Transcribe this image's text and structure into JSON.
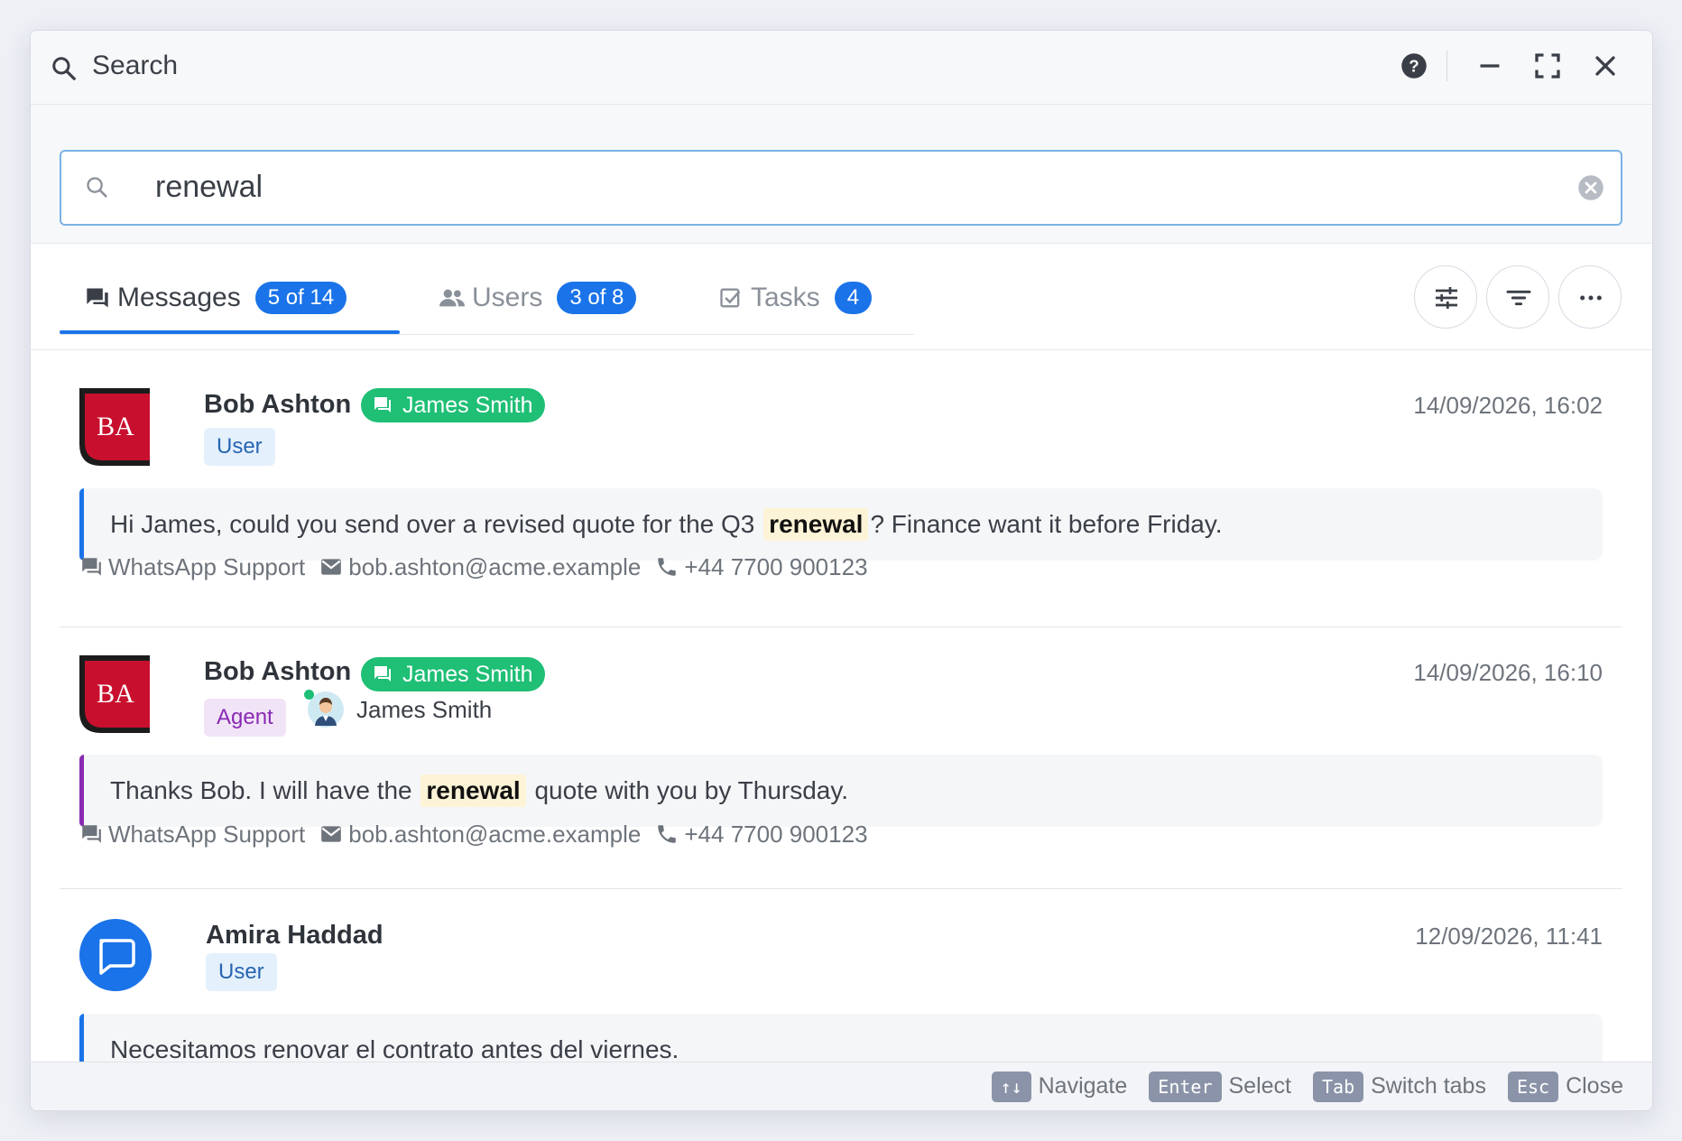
{
  "window": {
    "title": "Search",
    "controls": {
      "help": "help-icon",
      "minimize": "minimize-icon",
      "maximize": "fullscreen-icon",
      "close": "close-icon"
    }
  },
  "search": {
    "value": "renewal",
    "placeholder": ""
  },
  "tabs": [
    {
      "label": "Messages",
      "badge": "5 of 14",
      "icon": "chat-icon",
      "active": true
    },
    {
      "label": "Users",
      "badge": "3 of 8",
      "icon": "users-icon",
      "active": false
    },
    {
      "label": "Tasks",
      "badge": "4",
      "icon": "checkbox-icon",
      "active": false
    }
  ],
  "actions": [
    "settings-sliders-icon",
    "filter-icon",
    "more-icon"
  ],
  "results": [
    {
      "avatar_initials": "BA",
      "name": "Bob Ashton",
      "channel_chip": "James Smith",
      "role": "User",
      "time": "14/09/2026, 16:02",
      "message_before": "Hi James, could you send over a revised quote for the Q3 ",
      "message_highlight": "renewal",
      "message_after": "? Finance want it before Friday.",
      "channel": "WhatsApp Support",
      "email": "bob.ashton@acme.example",
      "phone": "+44 7700 900123"
    },
    {
      "avatar_initials": "BA",
      "name": "Bob Ashton",
      "channel_chip": "James Smith",
      "role": "Agent",
      "agent_name": "James Smith",
      "time": "14/09/2026, 16:10",
      "message_before": "Thanks Bob. I will have the ",
      "message_highlight": "renewal",
      "message_after": " quote with you by Thursday.",
      "channel": "WhatsApp Support",
      "email": "bob.ashton@acme.example",
      "phone": "+44 7700 900123"
    },
    {
      "name": "Amira Haddad",
      "role": "User",
      "time": "12/09/2026, 11:41",
      "message": "Necesitamos renovar el contrato antes del viernes."
    }
  ],
  "footer": {
    "navigate_key": "↑↓",
    "navigate": "Navigate",
    "enter_key": "Enter",
    "enter": "Select",
    "tab_key": "Tab",
    "tab": "Switch tabs",
    "esc_key": "Esc",
    "esc": "Close"
  },
  "colors": {
    "accent": "#1a73e8",
    "green": "#1fbf75",
    "avatar_red": "#c8102e",
    "agent_purple": "#8a2ab4"
  }
}
